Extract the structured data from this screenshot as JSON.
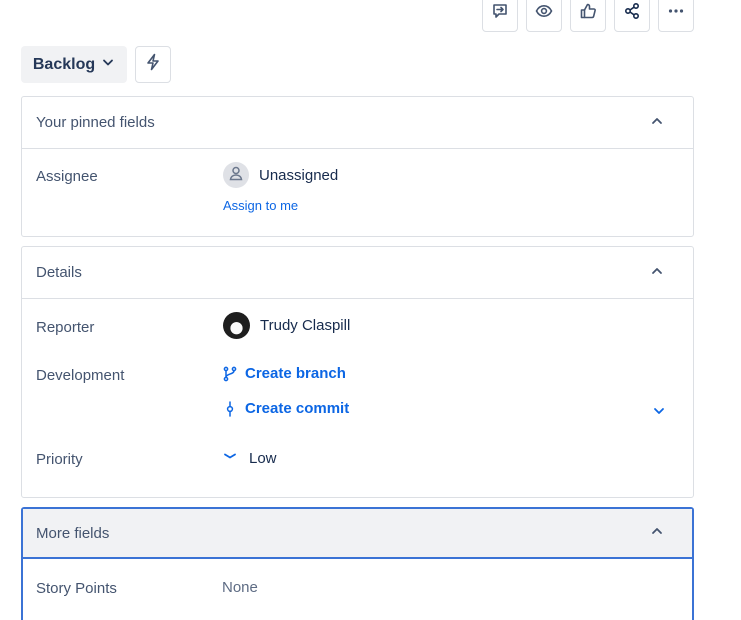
{
  "toolbar": {
    "buttons": [
      {
        "name": "feedback-button",
        "icon": "comment-arrow-icon"
      },
      {
        "name": "watch-button",
        "icon": "eye-icon"
      },
      {
        "name": "like-button",
        "icon": "thumbs-up-icon"
      },
      {
        "name": "share-button",
        "icon": "share-icon"
      },
      {
        "name": "more-actions-button",
        "icon": "more-horizontal-icon"
      }
    ]
  },
  "status": {
    "label": "Backlog"
  },
  "pinned": {
    "title": "Your pinned fields",
    "assignee_label": "Assignee",
    "assignee_value": "Unassigned",
    "assign_to_me": "Assign to me"
  },
  "details": {
    "title": "Details",
    "reporter_label": "Reporter",
    "reporter_value": "Trudy Claspill",
    "development_label": "Development",
    "create_branch": "Create branch",
    "create_commit": "Create commit",
    "priority_label": "Priority",
    "priority_value": "Low"
  },
  "more_fields": {
    "title": "More fields",
    "story_points_label": "Story Points",
    "story_points_value": "None"
  },
  "colors": {
    "link": "#0c66e4",
    "focus_border": "#3b73d5",
    "label": "#44546f",
    "priority_low": "#0c66e4"
  }
}
